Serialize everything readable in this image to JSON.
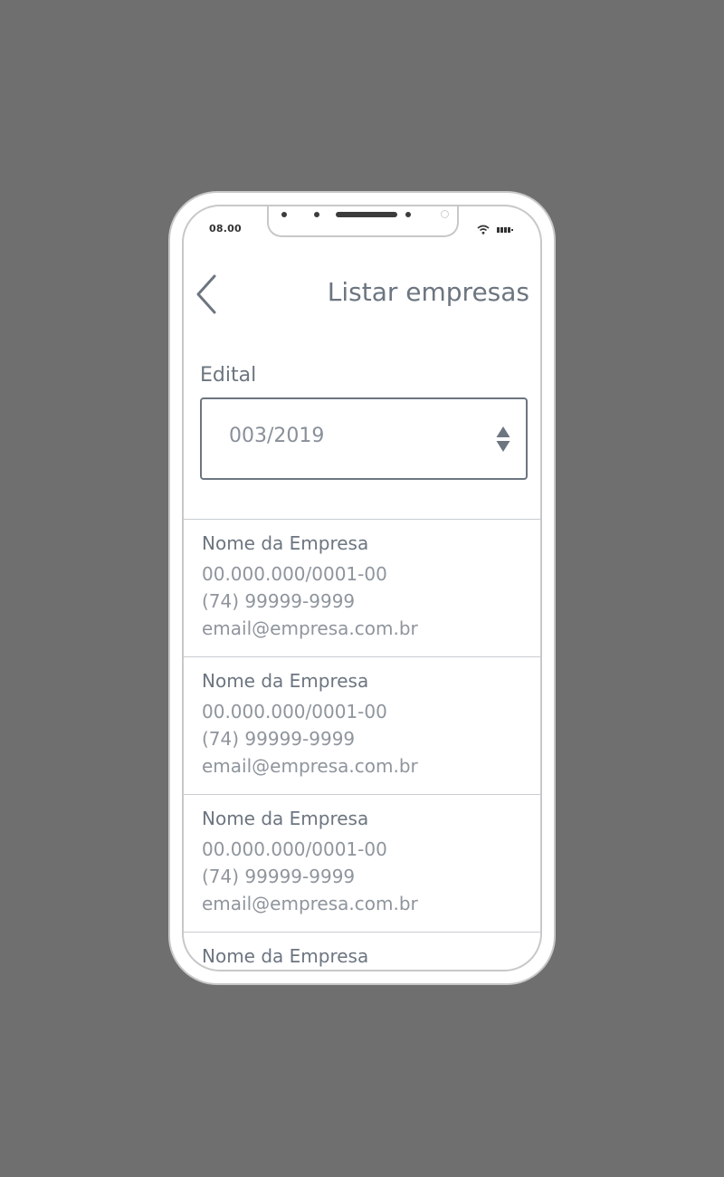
{
  "status_bar": {
    "time": "08.00",
    "wifi_icon": "wifi-icon",
    "battery_icon": "battery-icon"
  },
  "header": {
    "back_icon": "chevron-left-icon",
    "title": "Listar empresas"
  },
  "edital": {
    "label": "Edital",
    "selected": "003/2019",
    "arrow_icon": "sort-arrows-icon"
  },
  "companies": [
    {
      "name": "Nome da Empresa",
      "cnpj": "00.000.000/0001-00",
      "phone": "(74) 99999-9999",
      "email": "email@empresa.com.br"
    },
    {
      "name": "Nome da Empresa",
      "cnpj": "00.000.000/0001-00",
      "phone": "(74) 99999-9999",
      "email": "email@empresa.com.br"
    },
    {
      "name": "Nome da Empresa",
      "cnpj": "00.000.000/0001-00",
      "phone": "(74) 99999-9999",
      "email": "email@empresa.com.br"
    },
    {
      "name": "Nome da Empresa"
    }
  ],
  "colors": {
    "background": "#6f6f6f",
    "text_primary": "#6c7580",
    "text_secondary": "#8f959d",
    "divider": "#c9ccd1"
  }
}
